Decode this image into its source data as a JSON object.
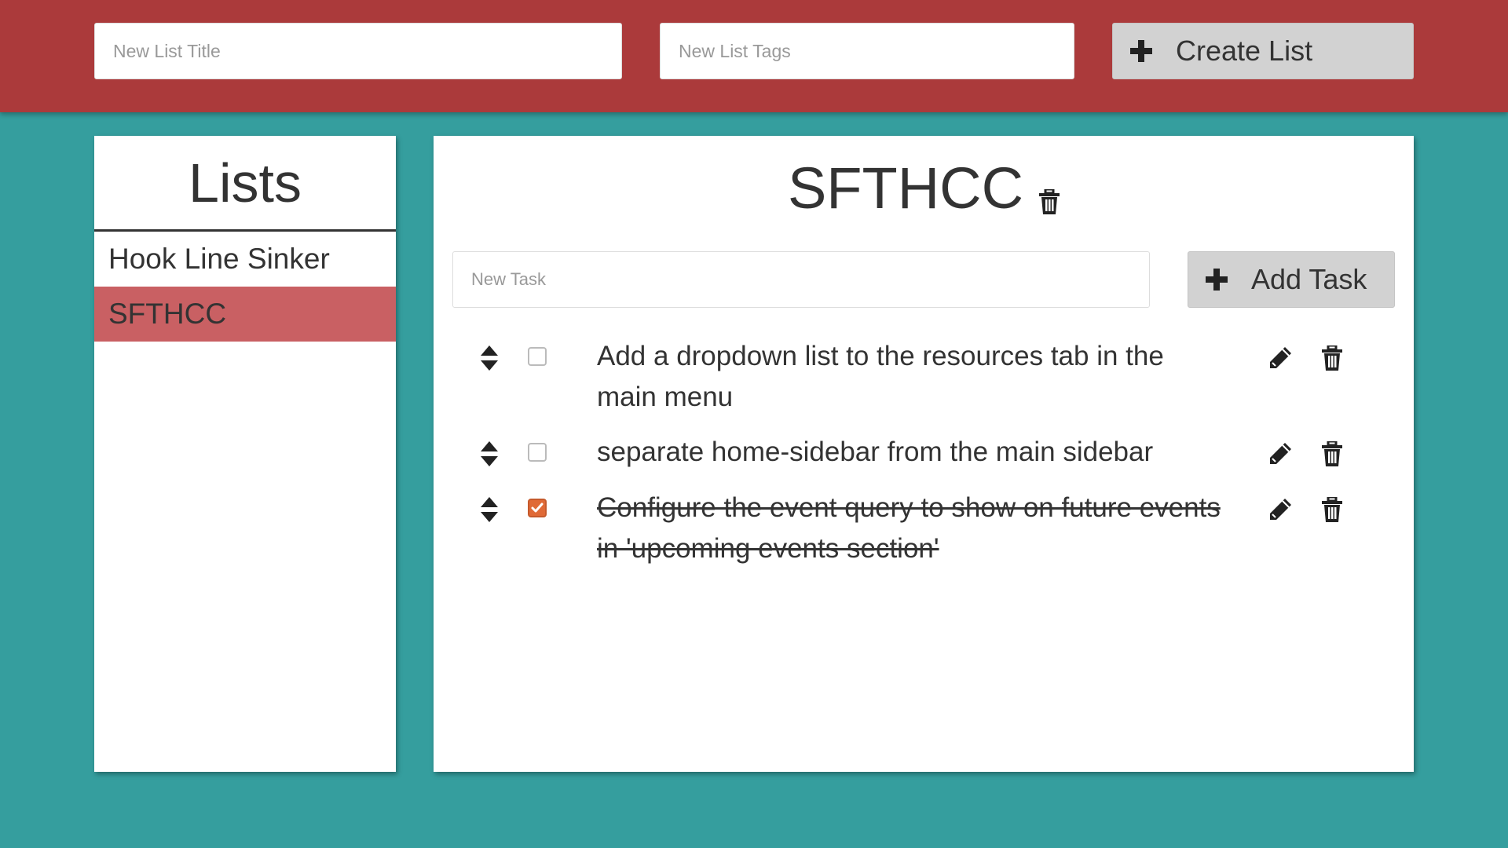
{
  "header": {
    "list_title_placeholder": "New List Title",
    "list_tags_placeholder": "New List Tags",
    "create_list_label": "Create List"
  },
  "sidebar": {
    "title": "Lists",
    "items": [
      {
        "label": "Hook Line Sinker",
        "active": false
      },
      {
        "label": "SFTHCC",
        "active": true
      }
    ]
  },
  "detail": {
    "title": "SFTHCC",
    "new_task_placeholder": "New Task",
    "add_task_label": "Add Task",
    "tasks": [
      {
        "text": "Add a dropdown list to the resources tab in the main menu",
        "done": false
      },
      {
        "text": "separate home-sidebar from the main sidebar",
        "done": false
      },
      {
        "text": "Configure the event query to show on future events in 'upcoming events section'",
        "done": true
      }
    ]
  },
  "colors": {
    "header_bg": "#ab3a3b",
    "page_bg": "#359e9e",
    "active_item_bg": "#c96063",
    "checked_box": "#e06a37"
  },
  "icons": {
    "plus": "plus-icon",
    "trash": "trash-icon",
    "edit": "pencil-icon",
    "sort": "sort-icon",
    "check": "check-icon"
  }
}
